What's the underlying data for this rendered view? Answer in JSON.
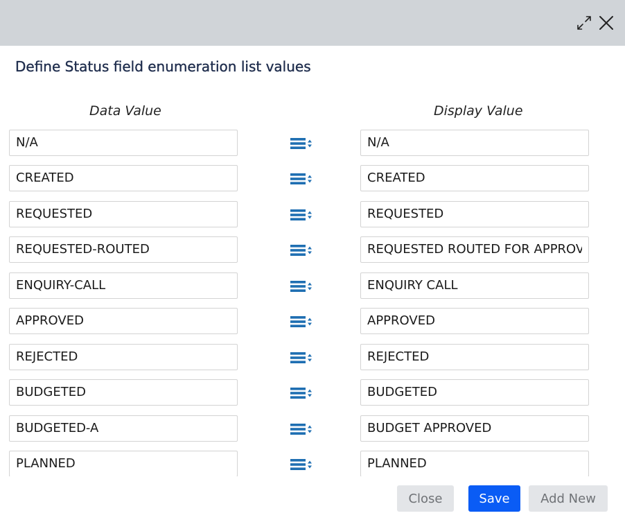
{
  "dialog": {
    "title": "Define Status field enumeration list values",
    "columns": {
      "data_value": "Data Value",
      "display_value": "Display Value"
    },
    "icons": {
      "maximize": "expand-arrows-icon",
      "close": "close-x-icon",
      "reorder": "drag-reorder-icon"
    },
    "colors": {
      "accent": "#0a5cf5",
      "reorder_icon": "#1f6fb2",
      "titlebar": "#d0d4d8"
    },
    "rows": [
      {
        "data": "N/A",
        "display": "N/A"
      },
      {
        "data": "CREATED",
        "display": "CREATED"
      },
      {
        "data": "REQUESTED",
        "display": "REQUESTED"
      },
      {
        "data": "REQUESTED-ROUTED",
        "display": "REQUESTED ROUTED FOR APPROVAL"
      },
      {
        "data": "ENQUIRY-CALL",
        "display": "ENQUIRY CALL"
      },
      {
        "data": "APPROVED",
        "display": "APPROVED"
      },
      {
        "data": "REJECTED",
        "display": "REJECTED"
      },
      {
        "data": "BUDGETED",
        "display": "BUDGETED"
      },
      {
        "data": "BUDGETED-A",
        "display": "BUDGET APPROVED"
      },
      {
        "data": "PLANNED",
        "display": "PLANNED"
      }
    ],
    "buttons": {
      "close": "Close",
      "save": "Save",
      "add_new": "Add New"
    }
  }
}
